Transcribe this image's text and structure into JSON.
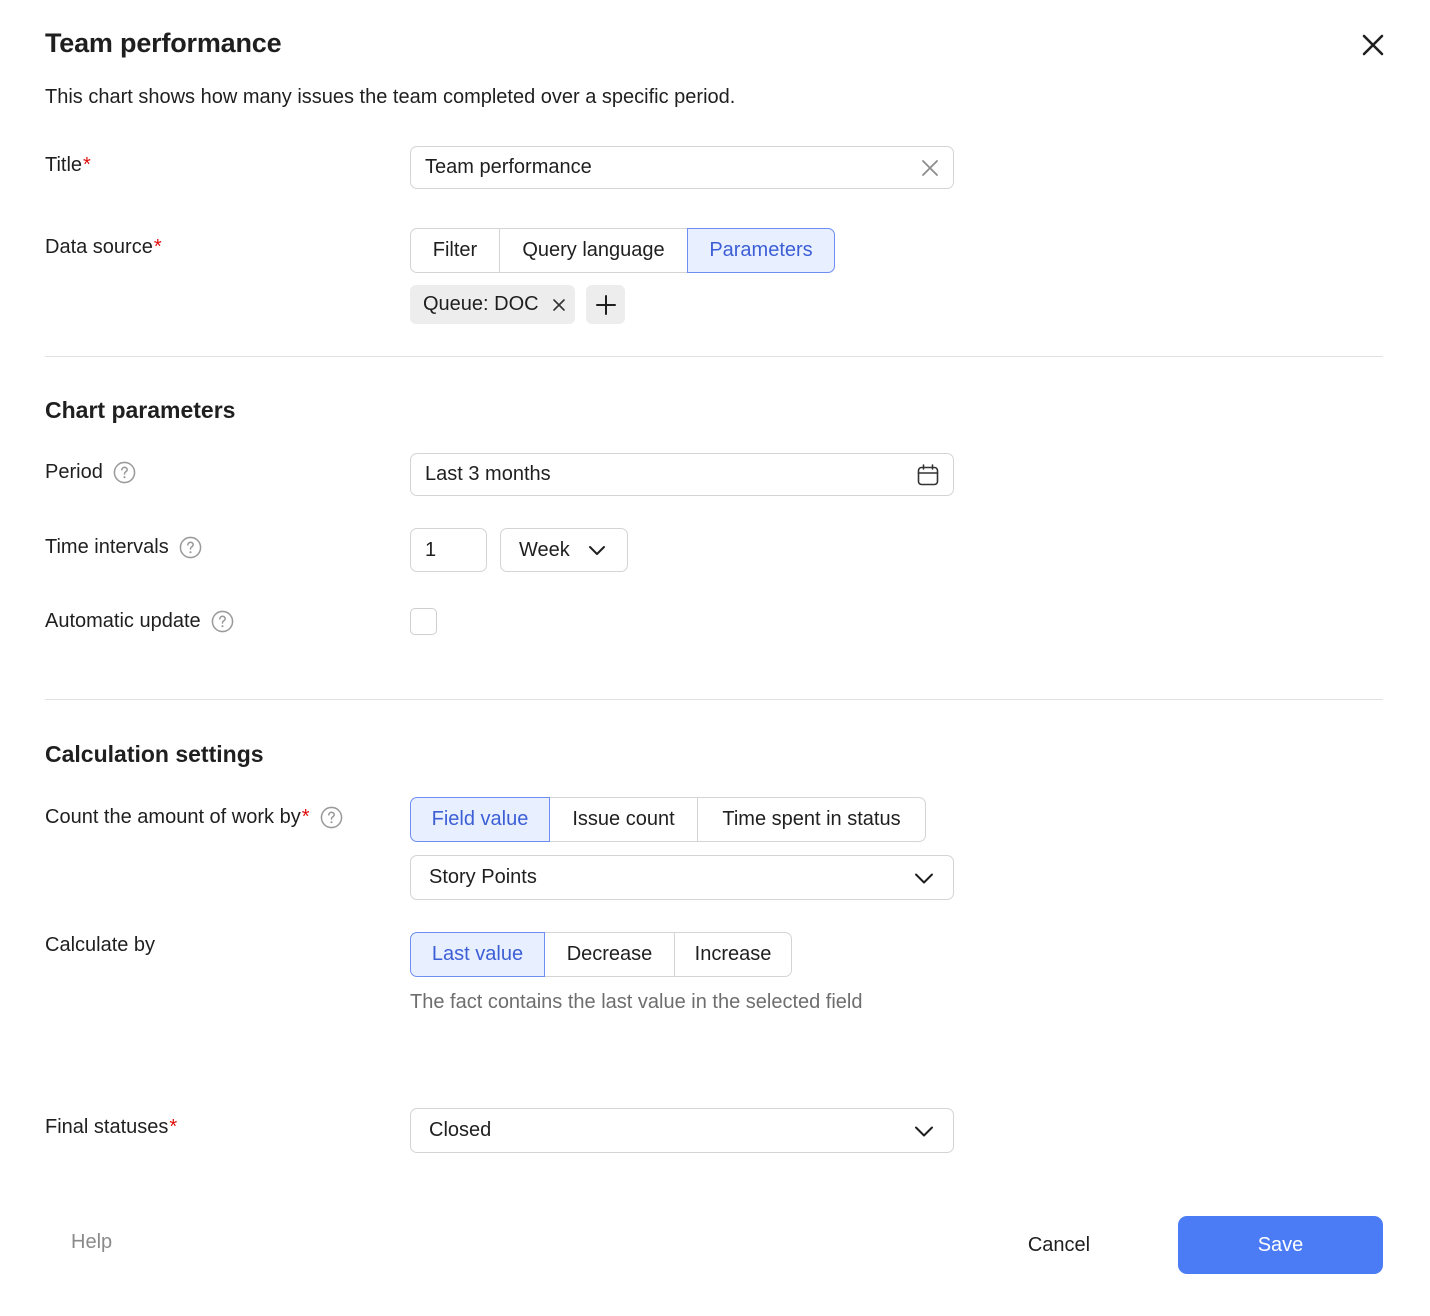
{
  "dialog": {
    "title": "Team performance",
    "description": "This chart shows how many issues the team completed over a specific period."
  },
  "fields": {
    "title": {
      "label": "Title",
      "required_mark": "*",
      "value": "Team performance"
    },
    "data_source": {
      "label": "Data source",
      "required_mark": "*",
      "tabs": [
        "Filter",
        "Query language",
        "Parameters"
      ],
      "selected_tab": "Parameters",
      "chips": [
        "Queue: DOC"
      ]
    }
  },
  "chart_parameters": {
    "heading": "Chart parameters",
    "period": {
      "label": "Period",
      "value": "Last 3 months"
    },
    "time_intervals": {
      "label": "Time intervals",
      "count": "1",
      "unit": "Week"
    },
    "automatic_update": {
      "label": "Automatic update",
      "checked": false
    }
  },
  "calculation_settings": {
    "heading": "Calculation settings",
    "count_by": {
      "label": "Count the amount of work by",
      "required_mark": "*",
      "options": [
        "Field value",
        "Issue count",
        "Time spent in status"
      ],
      "selected": "Field value",
      "field": "Story Points"
    },
    "calculate_by": {
      "label": "Calculate by",
      "options": [
        "Last value",
        "Decrease",
        "Increase"
      ],
      "selected": "Last value",
      "hint": "The fact contains the last value in the selected field"
    },
    "final_statuses": {
      "label": "Final statuses",
      "required_mark": "*",
      "value": "Closed"
    }
  },
  "footer": {
    "help": "Help",
    "cancel": "Cancel",
    "save": "Save"
  },
  "colors": {
    "accent": "#4b7cf5",
    "selected_bg": "#e8efff",
    "selected_text": "#3d5fd6",
    "required": "#e00d0d"
  }
}
